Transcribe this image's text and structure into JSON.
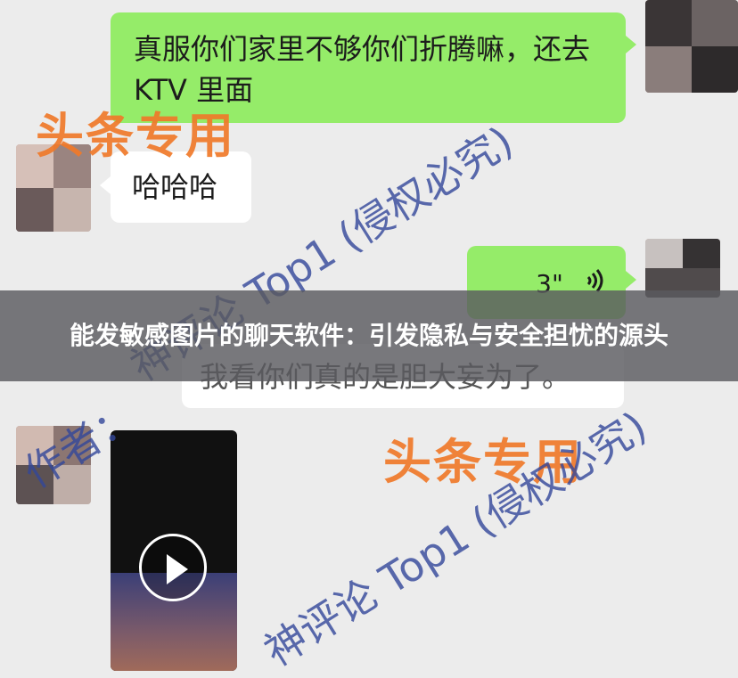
{
  "messages": {
    "m1_text": "真服你们家里不够你们折腾嘛，还去 KTV 里面",
    "m2_text": "哈哈哈",
    "m3_voice_duration": "3\"",
    "m4_text": "我看你们真的是胆大妄为了。"
  },
  "watermarks": {
    "orange_1": "头条专用",
    "orange_2": "头条专用",
    "blue_1": "神评论 Top1 (侵权必究)",
    "blue_2": "作者：",
    "blue_3": "神评论 Top1 (侵权必究)"
  },
  "banner": {
    "title": "能发敏感图片的聊天软件：引发隐私与安全担忧的源头"
  },
  "icons": {
    "voice": "voice-wave-icon",
    "play": "play-icon"
  },
  "colors": {
    "green_bubble": "#95ec69",
    "white_bubble": "#ffffff",
    "background": "#ececec",
    "orange_watermark": "#f07a2a",
    "blue_watermark": "#33479a"
  }
}
